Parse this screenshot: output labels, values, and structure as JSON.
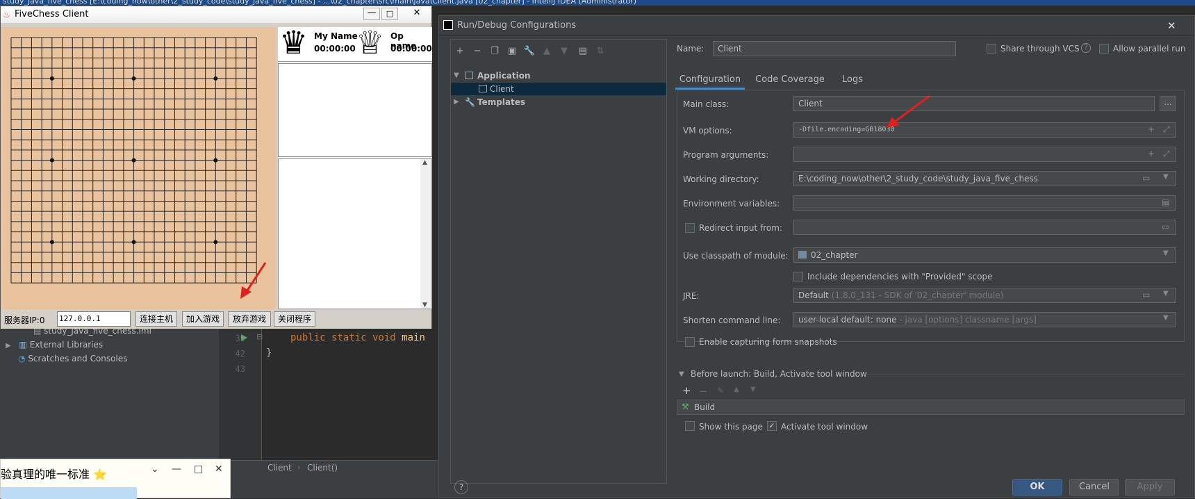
{
  "ide": {
    "title": "study_java_five_chess [E:\\coding_now\\other\\2_study_code\\study_java_five_chess] - ...\\02_chapter\\src\\main\\java\\Client.java [02_chapter] - IntelliJ IDEA (Administrator)",
    "tree": [
      {
        "label": "study_java_five_chess.iml",
        "icon": "module-file-icon"
      },
      {
        "label": "External Libraries",
        "icon": "library-icon"
      },
      {
        "label": "Scratches and Consoles",
        "icon": "scratch-icon"
      }
    ],
    "line_numbers": [
      "39",
      "42",
      "43"
    ],
    "code": {
      "line1_kw": "public static void ",
      "line1_name": "main",
      "line2": "}"
    },
    "breadcrumb": [
      "Client",
      "Client()"
    ]
  },
  "fivechess": {
    "title": "FiveChess Client",
    "my_label": "My Name",
    "my_time": "00:00:00",
    "op_label": "Op name",
    "op_time": "00:00:00",
    "server_ip_label": "服务器IP:0",
    "server_ip_value": "127.0.0.1",
    "buttons": [
      "连接主机",
      "加入游戏",
      "放弃游戏",
      "关闭程序"
    ]
  },
  "popup": {
    "text": "验真理的唯一标准 ⭐"
  },
  "dialog": {
    "title": "Run/Debug Configurations",
    "tree": {
      "application": "Application",
      "client": "Client",
      "templates": "Templates"
    },
    "name_label": "Name:",
    "name_value": "Client",
    "share_vcs": "Share through VCS",
    "allow_parallel": "Allow parallel run",
    "tabs": [
      "Configuration",
      "Code Coverage",
      "Logs"
    ],
    "active_tab": "Configuration",
    "fields": {
      "main_class_label": "Main class:",
      "main_class_value": "Client",
      "vm_options_label": "VM options:",
      "vm_options_value": "-Dfile.encoding=GB18030",
      "program_args_label": "Program arguments:",
      "program_args_value": "",
      "working_dir_label": "Working directory:",
      "working_dir_value": "E:\\coding_now\\other\\2_study_code\\study_java_five_chess",
      "env_vars_label": "Environment variables:",
      "redirect_label": "Redirect input from:",
      "classpath_label": "Use classpath of module:",
      "classpath_value": "02_chapter",
      "include_deps": "Include dependencies with \"Provided\" scope",
      "jre_label": "JRE:",
      "jre_value": "Default",
      "jre_hint": "(1.8.0_131 - SDK of '02_chapter' module)",
      "shorten_label": "Shorten command line:",
      "shorten_value": "user-local default: none",
      "shorten_hint": "- java [options] classname [args]",
      "capture_snapshots": "Enable capturing form snapshots"
    },
    "before_launch": {
      "title": "Before launch: Build, Activate tool window",
      "item": "Build",
      "show_page": "Show this page",
      "activate_window": "Activate tool window"
    },
    "buttons": {
      "help": "?",
      "ok": "OK",
      "cancel": "Cancel",
      "apply": "Apply"
    }
  },
  "colors": {
    "accent_blue": "#365880",
    "ok_button": "#365880",
    "arrow": "#e02020",
    "board": "#e8c39e",
    "keyword": "#cc7832",
    "method": "#ffc66d"
  }
}
